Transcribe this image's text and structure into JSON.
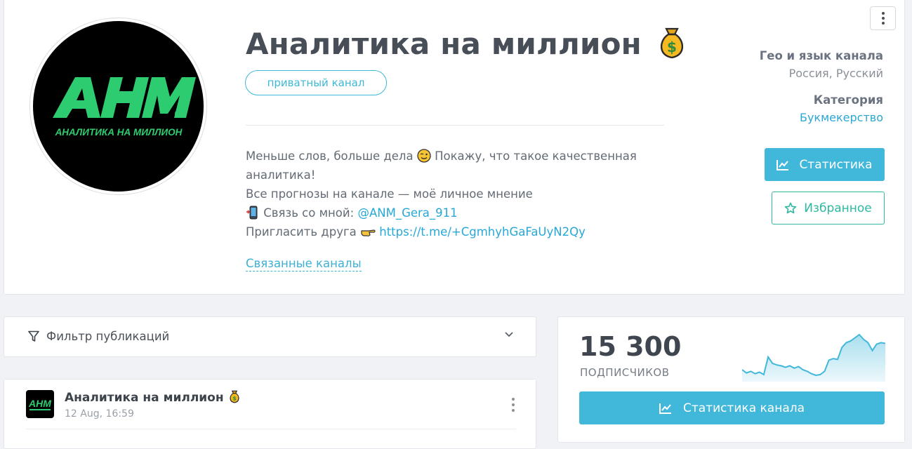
{
  "channel": {
    "title": "Аналитика на миллион",
    "badge": "приватный канал",
    "logo_text": "АНМ",
    "logo_subtext": "АНАЛИТИКА НА МИЛЛИОН",
    "description": {
      "line1_a": "Меньше слов, больше дела",
      "line1_b": "Покажу, что такое качественная",
      "line2": "аналитика!",
      "line3": "Все прогнозы на канале — моё личное мнение",
      "line4_label": "Связь со мной:",
      "line4_link": "@ANM_Gera_911",
      "line5_label": "Пригласить друга",
      "line5_link": "https://t.me/+CgmhyhGaFaUyN2Qy"
    },
    "related_link": "Связанные каналы"
  },
  "meta": {
    "geo_label": "Гео и язык канала",
    "geo_value": "Россия, Русский",
    "category_label": "Категория",
    "category_value": "Букмекерство"
  },
  "buttons": {
    "stats": "Статистика",
    "favorite": "Избранное",
    "channel_stats": "Статистика канала"
  },
  "filter": {
    "label": "Фильтр публикаций"
  },
  "post": {
    "title": "Аналитика на миллион",
    "date": "12 Aug, 16:59",
    "avatar_text": "АНМ"
  },
  "stats": {
    "subscribers": "15 300",
    "subscribers_label": "ПОДПИСЧИКОВ",
    "sparkline_values": [
      52,
      48,
      50,
      47,
      49,
      46,
      68,
      60,
      58,
      57,
      55,
      57,
      54,
      56,
      52,
      50,
      47,
      45,
      46,
      50,
      64,
      66,
      65,
      80,
      86,
      88,
      92,
      96,
      90,
      86,
      76,
      84,
      86,
      85
    ],
    "color": "#41b8da"
  },
  "colors": {
    "accent": "#41b8da",
    "favorite": "#2fb8a0",
    "logo_green": "#2ecc71"
  },
  "icons": [
    "moneybag-icon",
    "wink-emoji-icon",
    "phone-icon",
    "pointing-hand-icon",
    "chart-icon",
    "star-icon",
    "filter-icon",
    "chevron-down-icon",
    "kebab-menu-icon"
  ]
}
